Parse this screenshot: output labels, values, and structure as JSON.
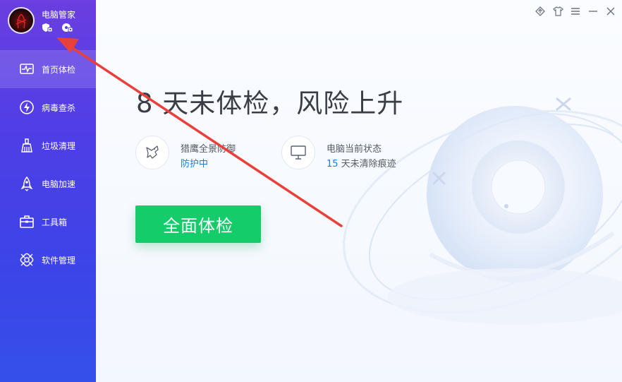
{
  "app": {
    "name": "电脑管家"
  },
  "sidebar": {
    "items": [
      {
        "label": "首页体检",
        "icon": "heartbeat-monitor-icon",
        "active": true
      },
      {
        "label": "病毒查杀",
        "icon": "lightning-shield-icon",
        "active": false
      },
      {
        "label": "垃圾清理",
        "icon": "broom-icon",
        "active": false
      },
      {
        "label": "电脑加速",
        "icon": "rocket-icon",
        "active": false
      },
      {
        "label": "工具箱",
        "icon": "toolbox-icon",
        "active": false
      },
      {
        "label": "软件管理",
        "icon": "app-grid-icon",
        "active": false
      }
    ]
  },
  "window_controls": [
    "feedback-icon",
    "skin-icon",
    "menu-icon",
    "minimize-icon",
    "close-icon"
  ],
  "main": {
    "headline": "8 天未体检，风险上升",
    "protection": {
      "title": "猎鹰全景防御",
      "status": "防护中",
      "icon": "falcon-icon"
    },
    "pc_status": {
      "title": "电脑当前状态",
      "count": "15",
      "suffix": " 天未清除痕迹",
      "icon": "monitor-icon"
    },
    "scan_button": "全面体检"
  },
  "colors": {
    "sidebar_top": "#6a3ee0",
    "sidebar_bottom": "#3550ea",
    "accent_green": "#14cc6a",
    "accent_blue": "#1f7bd8",
    "annotation_red": "#e8413c"
  }
}
